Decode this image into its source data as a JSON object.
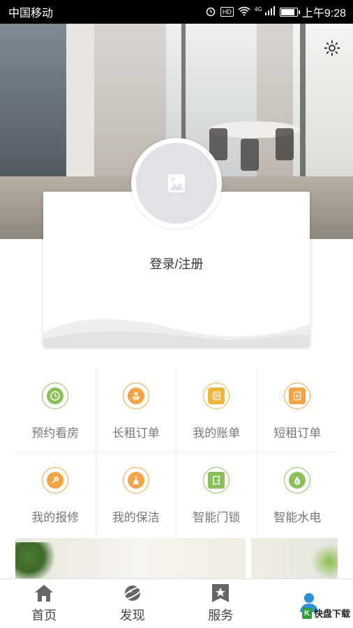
{
  "status_bar": {
    "carrier": "中国移动",
    "network": "4G",
    "hd_badge": "HD",
    "time": "上午9:28"
  },
  "header": {
    "settings_icon": "gear-icon"
  },
  "profile": {
    "login_label": "登录/注册",
    "avatar_icon": "image-placeholder-icon"
  },
  "services": [
    {
      "label": "预约看房",
      "icon": "clock-icon",
      "color": "#8bbf5a"
    },
    {
      "label": "长租订单",
      "icon": "stamp-icon",
      "color": "#f5a445"
    },
    {
      "label": "我的账单",
      "icon": "notebook-icon",
      "color": "#f0b63a"
    },
    {
      "label": "短租订单",
      "icon": "document-icon",
      "color": "#f5a445"
    },
    {
      "label": "我的报修",
      "icon": "wrench-icon",
      "color": "#f5a445"
    },
    {
      "label": "我的保洁",
      "icon": "broom-icon",
      "color": "#f5a445"
    },
    {
      "label": "智能门锁",
      "icon": "door-icon",
      "color": "#8bbf5a"
    },
    {
      "label": "智能水电",
      "icon": "water-drop-icon",
      "color": "#8bbf5a"
    }
  ],
  "tabs": [
    {
      "label": "首页",
      "icon": "home-icon"
    },
    {
      "label": "发现",
      "icon": "planet-icon"
    },
    {
      "label": "服务",
      "icon": "star-badge-icon"
    },
    {
      "label": "",
      "icon": "user-icon",
      "active": true
    }
  ],
  "watermark": {
    "logo_letter": "K",
    "text": "快盘下载"
  },
  "colors": {
    "active_tab": "#2a8fd8",
    "inactive_tab": "#555555"
  }
}
